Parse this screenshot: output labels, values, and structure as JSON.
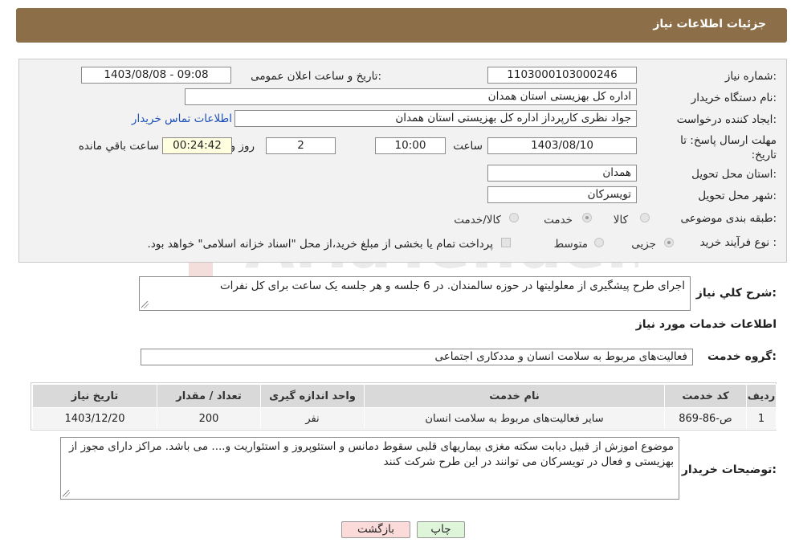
{
  "header": {
    "title": "جزئیات اطلاعات نیاز"
  },
  "form": {
    "need_number_label": "شماره نیاز:",
    "need_number": "1103000103000246",
    "announce_label": "تاریخ و ساعت اعلان عمومی:",
    "announce_value": "1403/08/08 - 09:08",
    "buyer_org_label": "نام دستگاه خریدار:",
    "buyer_org": "اداره کل بهزیستی استان همدان",
    "creator_label": "ایجاد کننده درخواست:",
    "creator": "جواد نظری کارپرداز اداره کل بهزیستی استان همدان",
    "contact_link": "اطلاعات تماس خریدار",
    "deadline_label": "مهلت ارسال پاسخ: تا تاریخ:",
    "deadline_date": "1403/08/10",
    "time_label": "ساعت",
    "deadline_time": "10:00",
    "days_value": "2",
    "days_label": "روز و",
    "remaining_time": "00:24:42",
    "remaining_label": "ساعت باقي مانده",
    "province_label": "استان محل تحویل:",
    "province": "همدان",
    "city_label": "شهر محل تحویل:",
    "city": "تویسرکان",
    "category_label": "طبقه بندی موضوعی:",
    "category_options": [
      "کالا",
      "خدمت",
      "کالا/خدمت"
    ],
    "category_selected": "خدمت",
    "purchase_type_label": "نوع فرآیند خرید :",
    "purchase_options": [
      "جزیی",
      "متوسط"
    ],
    "payment_note": "پرداخت تمام یا بخشی از مبلغ خرید،از محل \"اسناد خزانه اسلامی\" خواهد بود."
  },
  "summary": {
    "label": "شرح کلي نياز:",
    "text": "اجرای طرح پیشگیری از معلولیتها در حوزه سالمندان.  در 6 جلسه و هر جلسه یک ساعت برای کل نفرات"
  },
  "services_title": "اطلاعات خدمات مورد نياز",
  "service_group": {
    "label": "گروه خدمت:",
    "value": "فعالیت‌های مربوط به سلامت انسان و مددکاری اجتماعی"
  },
  "table": {
    "headers": [
      "ردیف",
      "کد خدمت",
      "نام خدمت",
      "واحد اندازه گیری",
      "تعداد / مقدار",
      "تاریخ نیاز"
    ],
    "rows": [
      [
        "1",
        "ص-86-869",
        "سایر فعالیت‌های مربوط به سلامت انسان",
        "نفر",
        "200",
        "1403/12/20"
      ]
    ]
  },
  "buyer_notes": {
    "label": "توضیحات خریدار:",
    "text": "موضوع اموزش از قبیل دیابت سکته مغزی بیماریهای قلبی سقوط دمانس و استئوپروز و استئواریت و.... می باشد. مراکز دارای مجوز از بهزیستی و فعال در تویسرکان می توانند در این طرح شرکت کنند"
  },
  "buttons": {
    "print": "چاپ",
    "back": "بازگشت"
  },
  "watermark": {
    "text": "AriaTender.neT"
  },
  "colors": {
    "header_bg": "#8c6e48",
    "link": "#1a4fb8",
    "timer_bg": "#ffffe0",
    "back_bg": "#fbdada",
    "print_bg": "#dff5da"
  }
}
